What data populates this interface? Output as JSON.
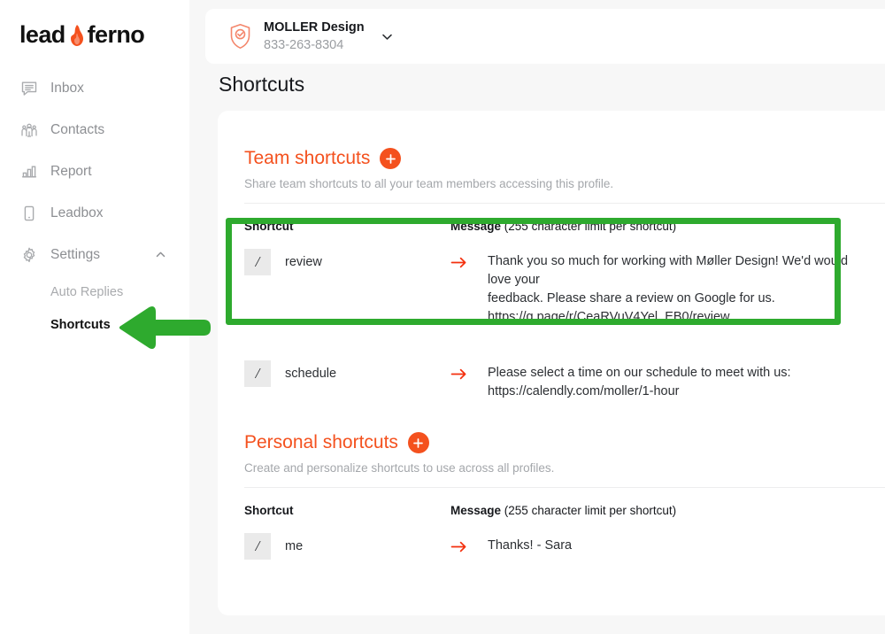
{
  "brand": {
    "name_part1": "lead",
    "name_part2": "ferno",
    "flame_icon": "flame-icon"
  },
  "sidebar": {
    "items": [
      {
        "label": "Inbox",
        "icon": "chat-bubble-icon"
      },
      {
        "label": "Contacts",
        "icon": "people-icon"
      },
      {
        "label": "Report",
        "icon": "bar-chart-icon"
      },
      {
        "label": "Leadbox",
        "icon": "mobile-phone-icon"
      },
      {
        "label": "Settings",
        "icon": "gear-icon",
        "chevron": "chevron-up-icon"
      }
    ],
    "subitems": [
      {
        "label": "Auto Replies",
        "active": false
      },
      {
        "label": "Shortcuts",
        "active": true
      }
    ]
  },
  "topbar": {
    "shield_icon": "shield-check-icon",
    "business_name": "MOLLER Design",
    "business_phone": "833-263-8304",
    "chevron_icon": "chevron-down-icon"
  },
  "page": {
    "title": "Shortcuts"
  },
  "team_section": {
    "title": "Team shortcuts",
    "add_icon": "plus-circle-icon",
    "subtitle": "Share team shortcuts to all your team members accessing this profile.",
    "col_shortcut": "Shortcut",
    "col_message_bold": "Message",
    "col_message_rest": " (255 character limit per shortcut)",
    "rows": [
      {
        "slash": "/",
        "key": "review",
        "arrow_icon": "arrow-right-icon",
        "message_lines": [
          "Thank you so much for working with Møller Design! We'd would love your",
          "feedback. Please share a review on Google for us.",
          "https://g.page/r/CeaRVuV4Yel_EB0/review"
        ]
      },
      {
        "slash": "/",
        "key": "schedule",
        "arrow_icon": "arrow-right-icon",
        "message_lines": [
          "Please select a time on our schedule to meet with us:",
          "https://calendly.com/moller/1-hour"
        ]
      }
    ]
  },
  "personal_section": {
    "title": "Personal shortcuts",
    "add_icon": "plus-circle-icon",
    "subtitle": "Create and personalize shortcuts to use across all profiles.",
    "col_shortcut": "Shortcut",
    "col_message_bold": "Message",
    "col_message_rest": " (255 character limit per shortcut)",
    "rows": [
      {
        "slash": "/",
        "key": "me",
        "arrow_icon": "arrow-right-icon",
        "message_lines": [
          "Thanks! - Sara"
        ]
      }
    ]
  },
  "annotations": {
    "highlight_color": "#2eaa2e",
    "arrow_color": "#2eaa2e",
    "highlight_target": "review-shortcut-row",
    "arrow_target": "sidebar-item-shortcuts"
  },
  "colors": {
    "accent": "#f4511e",
    "annotation": "#2eaa2e",
    "background": "#f7f7f7"
  }
}
